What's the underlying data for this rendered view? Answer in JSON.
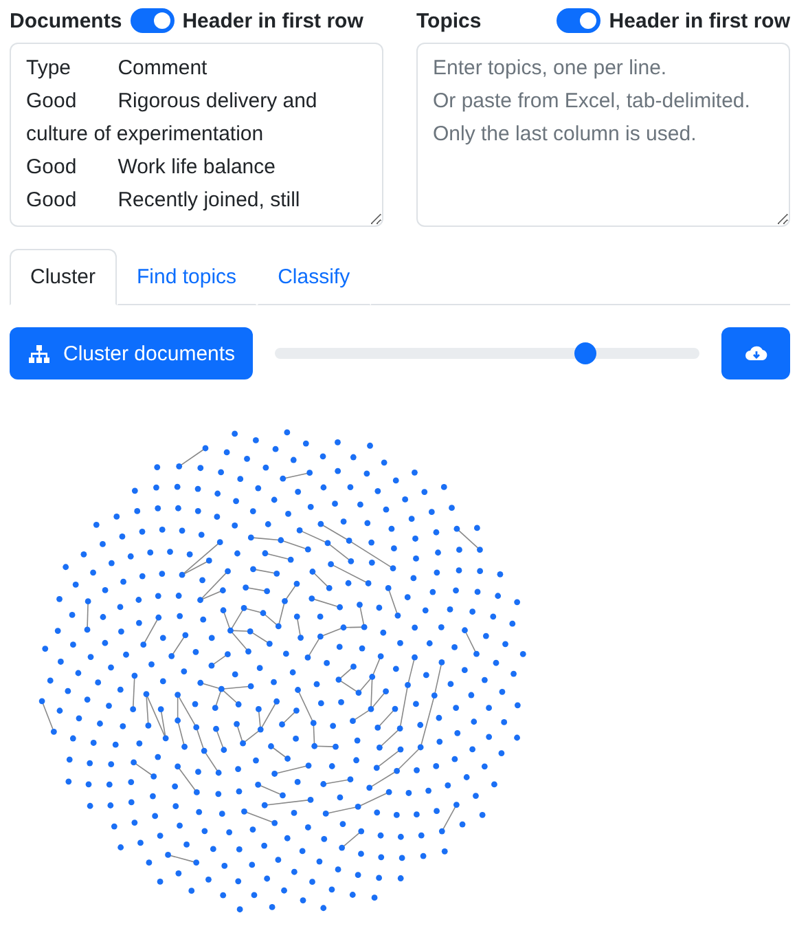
{
  "documents": {
    "label": "Documents",
    "header_switch": {
      "label": "Header in first row",
      "on": true
    },
    "value": "Type\tComment\nGood\tRigorous delivery and culture of experimentation\nGood\tWork life balance\nGood\tRecently joined, still"
  },
  "topics": {
    "label": "Topics",
    "header_switch": {
      "label": "Header in first row",
      "on": true
    },
    "placeholder": "Enter topics, one per line.\nOr paste from Excel, tab-delimited.\nOnly the last column is used."
  },
  "tabs": [
    {
      "label": "Cluster",
      "selected": true
    },
    {
      "label": "Find topics",
      "selected": false
    },
    {
      "label": "Classify",
      "selected": false
    }
  ],
  "cluster_button": {
    "label": "Cluster documents"
  },
  "slider": {
    "level": 0.73
  }
}
